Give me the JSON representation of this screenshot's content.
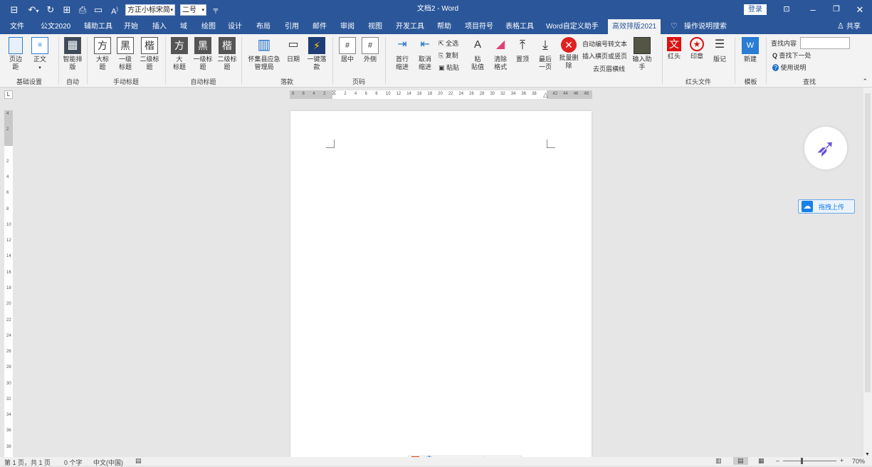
{
  "titlebar": {
    "doc_title": "文档2 - Word",
    "login": "登录",
    "font_name": "方正小标宋简",
    "font_size": "二号",
    "icons": [
      "save-icon",
      "undo-icon",
      "redo-icon",
      "save-as-icon",
      "print-preview-icon",
      "clipboard-icon",
      "font-size-icon"
    ]
  },
  "tabs": [
    "文件",
    "公文2020",
    "辅助工具",
    "开始",
    "插入",
    "域",
    "绘图",
    "设计",
    "布局",
    "引用",
    "邮件",
    "审阅",
    "视图",
    "开发工具",
    "帮助",
    "项目符号",
    "表格工具",
    "Word自定义助手",
    "高效排版2021"
  ],
  "tell_me": "操作说明搜索",
  "share": "共享",
  "ribbon": {
    "g1": {
      "label": "基础设置",
      "b1": "页边\n距",
      "b2": "正文"
    },
    "g2": {
      "label": "自动",
      "b1": "智能排\n版"
    },
    "g3": {
      "label": "手动标题",
      "b1": "大标\n题",
      "b2": "一级\n标题",
      "b3": "二级标\n题",
      "i1": "方",
      "i2": "黑",
      "i3": "楷"
    },
    "g4": {
      "label": "自动标题",
      "b1": "大\n标题",
      "b2": "一级标\n题",
      "b3": "二级标\n题",
      "i1": "方",
      "i2": "黑",
      "i3": "楷"
    },
    "g5": {
      "label": "落款",
      "b1": "怀集县应急\n管理局",
      "b2": "日期",
      "b3": "一键落\n款"
    },
    "g6": {
      "label": "页码",
      "b1": "居中",
      "b2": "外侧"
    },
    "g7": {
      "b1": "首行\n缩进",
      "b2": "取消\n缩进",
      "s1": "全选",
      "s2": "复制",
      "s3": "粘贴",
      "b3": "粘\n贴值",
      "b4": "清除\n格式",
      "b5": "置顶",
      "b6": "最后\n一页",
      "b7": "批量删\n除"
    },
    "g8": {
      "s1": "自动编号转文本",
      "s2": "插入横页或竖页",
      "s3": "去页眉横线",
      "b1": "输入助\n手"
    },
    "g9": {
      "label": "红头文件",
      "b1": "红头",
      "b2": "印章",
      "b3": "版记"
    },
    "g10": {
      "label": "模板",
      "b1": "新建"
    },
    "g11": {
      "label": "查找",
      "s1": "查找内容",
      "s2": "查找下一处",
      "s3": "使用说明"
    }
  },
  "ruler_h": [
    "8",
    "6",
    "4",
    "2",
    "",
    "2",
    "4",
    "6",
    "8",
    "10",
    "12",
    "14",
    "16",
    "18",
    "20",
    "22",
    "24",
    "26",
    "28",
    "30",
    "32",
    "34",
    "36",
    "38",
    "",
    "42",
    "44",
    "46",
    "48"
  ],
  "ruler_v": [
    "4",
    "2",
    "",
    "2",
    "4",
    "6",
    "8",
    "10",
    "12",
    "14",
    "16",
    "18",
    "20",
    "22",
    "24",
    "26",
    "28",
    "30",
    "32",
    "34",
    "36",
    "38"
  ],
  "float_upload": "拖拽上传",
  "status": {
    "page": "第 1 页，共 1 页",
    "words": "0 个字",
    "lang": "中文(中国)",
    "zoom": "70%"
  },
  "ime": "中"
}
